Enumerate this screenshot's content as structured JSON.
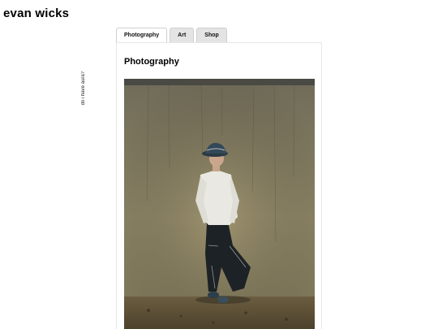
{
  "site": {
    "title": "evan wicks"
  },
  "side_text": "do i have aura?",
  "tabs": [
    {
      "label": "Photography",
      "active": true
    },
    {
      "label": "Art",
      "active": false
    },
    {
      "label": "Shop",
      "active": false
    }
  ],
  "panel": {
    "heading": "Photography",
    "photo": {
      "subject": "person-leaning-on-concrete-wall",
      "icon": "photo-image"
    }
  },
  "colors": {
    "tab_inactive": "#e4e4e4",
    "tab_active": "#ffffff",
    "border": "#cfcfcf"
  }
}
